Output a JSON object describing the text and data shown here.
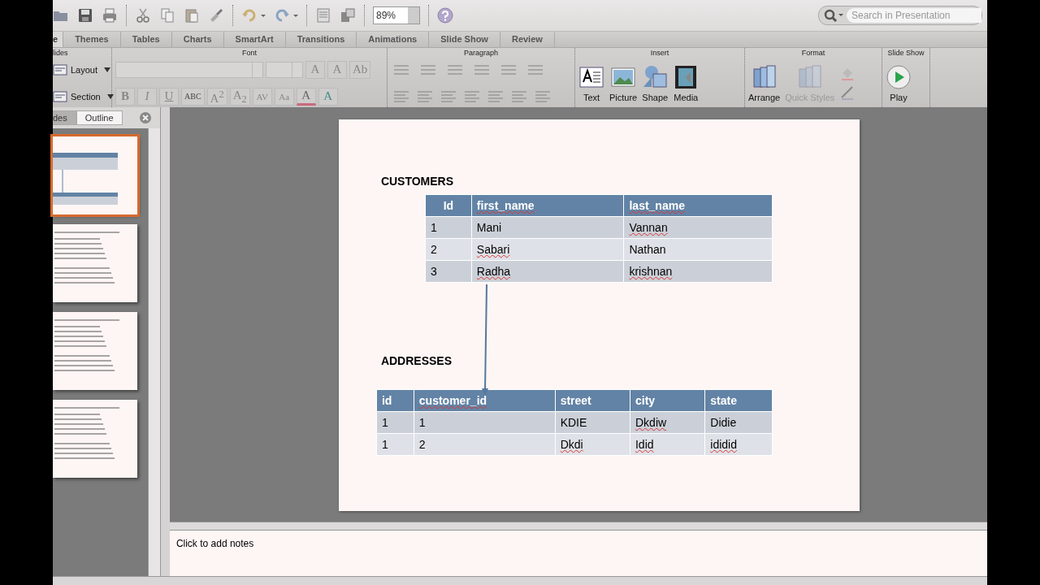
{
  "toolbar": {
    "zoom": "89%",
    "search": {
      "placeholder": "Search in Presentation"
    }
  },
  "tabs": [
    {
      "label": "e",
      "selected": true
    },
    {
      "label": "Themes",
      "selected": false
    },
    {
      "label": "Tables",
      "selected": false
    },
    {
      "label": "Charts",
      "selected": false
    },
    {
      "label": "SmartArt",
      "selected": false
    },
    {
      "label": "Transitions",
      "selected": false
    },
    {
      "label": "Animations",
      "selected": false
    },
    {
      "label": "Slide Show",
      "selected": false
    },
    {
      "label": "Review",
      "selected": false
    }
  ],
  "ribbon": {
    "slides_group": {
      "title": "lides",
      "buttons": [
        "Layout",
        "Section"
      ]
    },
    "font_group": {
      "title": "Font",
      "size_buttons": [
        "A",
        "A",
        "Ab"
      ],
      "style_buttons": [
        "B",
        "I",
        "U",
        "ABC",
        "A$^{2}$",
        "A$_{2}$",
        "AV",
        "Aa",
        "A",
        "A"
      ]
    },
    "paragraph_group": {
      "title": "Paragraph"
    },
    "insert_group": {
      "title": "Insert",
      "buttons": [
        "Text",
        "Picture",
        "Shape",
        "Media"
      ]
    },
    "format_group": {
      "title": "Format",
      "buttons": [
        {
          "label": "Arrange",
          "disabled": false
        },
        {
          "label": "Quick Styles",
          "disabled": true
        }
      ]
    },
    "slideshow_group": {
      "title": "Slide Show",
      "buttons": [
        "Play"
      ]
    }
  },
  "left_pane": {
    "tabs": [
      {
        "label": "des",
        "selected": true
      },
      {
        "label": "Outline",
        "selected": false
      }
    ],
    "thumbnails": [
      {
        "selected": true
      },
      {
        "selected": false
      },
      {
        "selected": false
      },
      {
        "selected": false
      }
    ]
  },
  "slide": {
    "sections": [
      {
        "title": "CUSTOMERS",
        "columns": [
          {
            "text": "Id",
            "misspelled": false
          },
          {
            "text": "first_name",
            "misspelled": true
          },
          {
            "text": "last_name",
            "misspelled": true
          }
        ],
        "rows": [
          [
            {
              "text": "1",
              "misspelled": false
            },
            {
              "text": "Mani",
              "misspelled": false
            },
            {
              "text": "Vannan",
              "misspelled": true
            }
          ],
          [
            {
              "text": "2",
              "misspelled": false
            },
            {
              "text": "Sabari",
              "misspelled": true
            },
            {
              "text": "Nathan",
              "misspelled": false
            }
          ],
          [
            {
              "text": "3",
              "misspelled": false
            },
            {
              "text": "Radha",
              "misspelled": true
            },
            {
              "text": "krishnan",
              "misspelled": true
            }
          ]
        ]
      },
      {
        "title": "ADDRESSES",
        "columns": [
          {
            "text": "id",
            "misspelled": false
          },
          {
            "text": "customer_id",
            "misspelled": true
          },
          {
            "text": "street",
            "misspelled": false
          },
          {
            "text": "city",
            "misspelled": false
          },
          {
            "text": "state",
            "misspelled": false
          }
        ],
        "rows": [
          [
            {
              "text": "1",
              "misspelled": false
            },
            {
              "text": "1",
              "misspelled": false
            },
            {
              "text": "KDIE",
              "misspelled": false
            },
            {
              "text": "Dkdiw",
              "misspelled": true
            },
            {
              "text": "Didie",
              "misspelled": false
            }
          ],
          [
            {
              "text": "1",
              "misspelled": false
            },
            {
              "text": "2",
              "misspelled": false
            },
            {
              "text": "Dkdi",
              "misspelled": true
            },
            {
              "text": "Idid",
              "misspelled": true
            },
            {
              "text": "ididid",
              "misspelled": true
            }
          ]
        ]
      }
    ]
  },
  "notes": {
    "placeholder": "Click to add notes"
  }
}
